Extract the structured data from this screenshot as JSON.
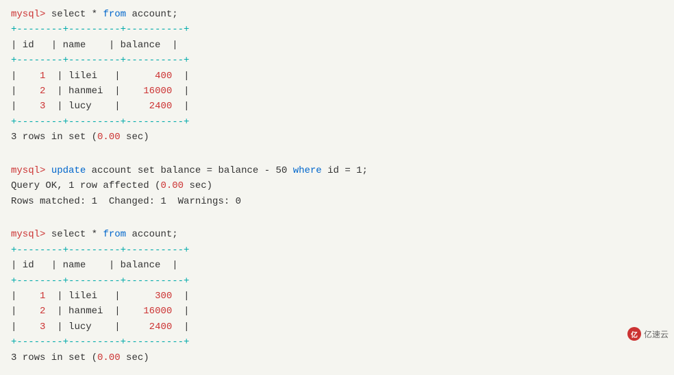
{
  "terminal": {
    "block1": {
      "prompt": "mysql>",
      "cmd_parts": [
        {
          "text": " select * ",
          "type": "normal"
        },
        {
          "text": "from",
          "type": "keyword"
        },
        {
          "text": " account;",
          "type": "normal"
        }
      ],
      "table": {
        "border_top": "+--------+---------+----------+",
        "header": "| id   | name    | balance  |",
        "border_mid": "+--------+---------+----------+",
        "rows": [
          "|    1  | lilei   |      400  |",
          "|    2  | hanmei  |    16000  |",
          "|    3  | lucy    |     2400  |"
        ],
        "border_bot": "+--------+---------+----------+"
      },
      "result": "3 rows in set (",
      "time": "0.00",
      "result_end": " sec)"
    },
    "block2": {
      "prompt": "mysql>",
      "cmd_keyword1": "update",
      "cmd_middle": " account set balance = balance - 50 ",
      "cmd_keyword2": "where",
      "cmd_end": " id = 1;",
      "line2": "Query OK, 1 row affected (",
      "time2": "0.00",
      "line2_end": " sec)",
      "line3": "Rows matched: 1  Changed: 1  Warnings: 0"
    },
    "block3": {
      "prompt": "mysql>",
      "cmd_parts": [
        {
          "text": " select * ",
          "type": "normal"
        },
        {
          "text": "from",
          "type": "keyword"
        },
        {
          "text": " account;",
          "type": "normal"
        }
      ],
      "table": {
        "border_top": "+--------+---------+----------+",
        "header": "| id   | name    | balance  |",
        "border_mid": "+--------+---------+----------+",
        "rows": [
          "|    1  | lilei   |      300  |",
          "|    2  | hanmei  |    16000  |",
          "|    3  | lucy    |     2400  |"
        ],
        "border_bot": "+--------+---------+----------+"
      },
      "result": "3 rows in set (",
      "time": "0.00",
      "result_end": " sec)"
    }
  },
  "watermark": {
    "logo": "亿",
    "text": "亿速云"
  }
}
